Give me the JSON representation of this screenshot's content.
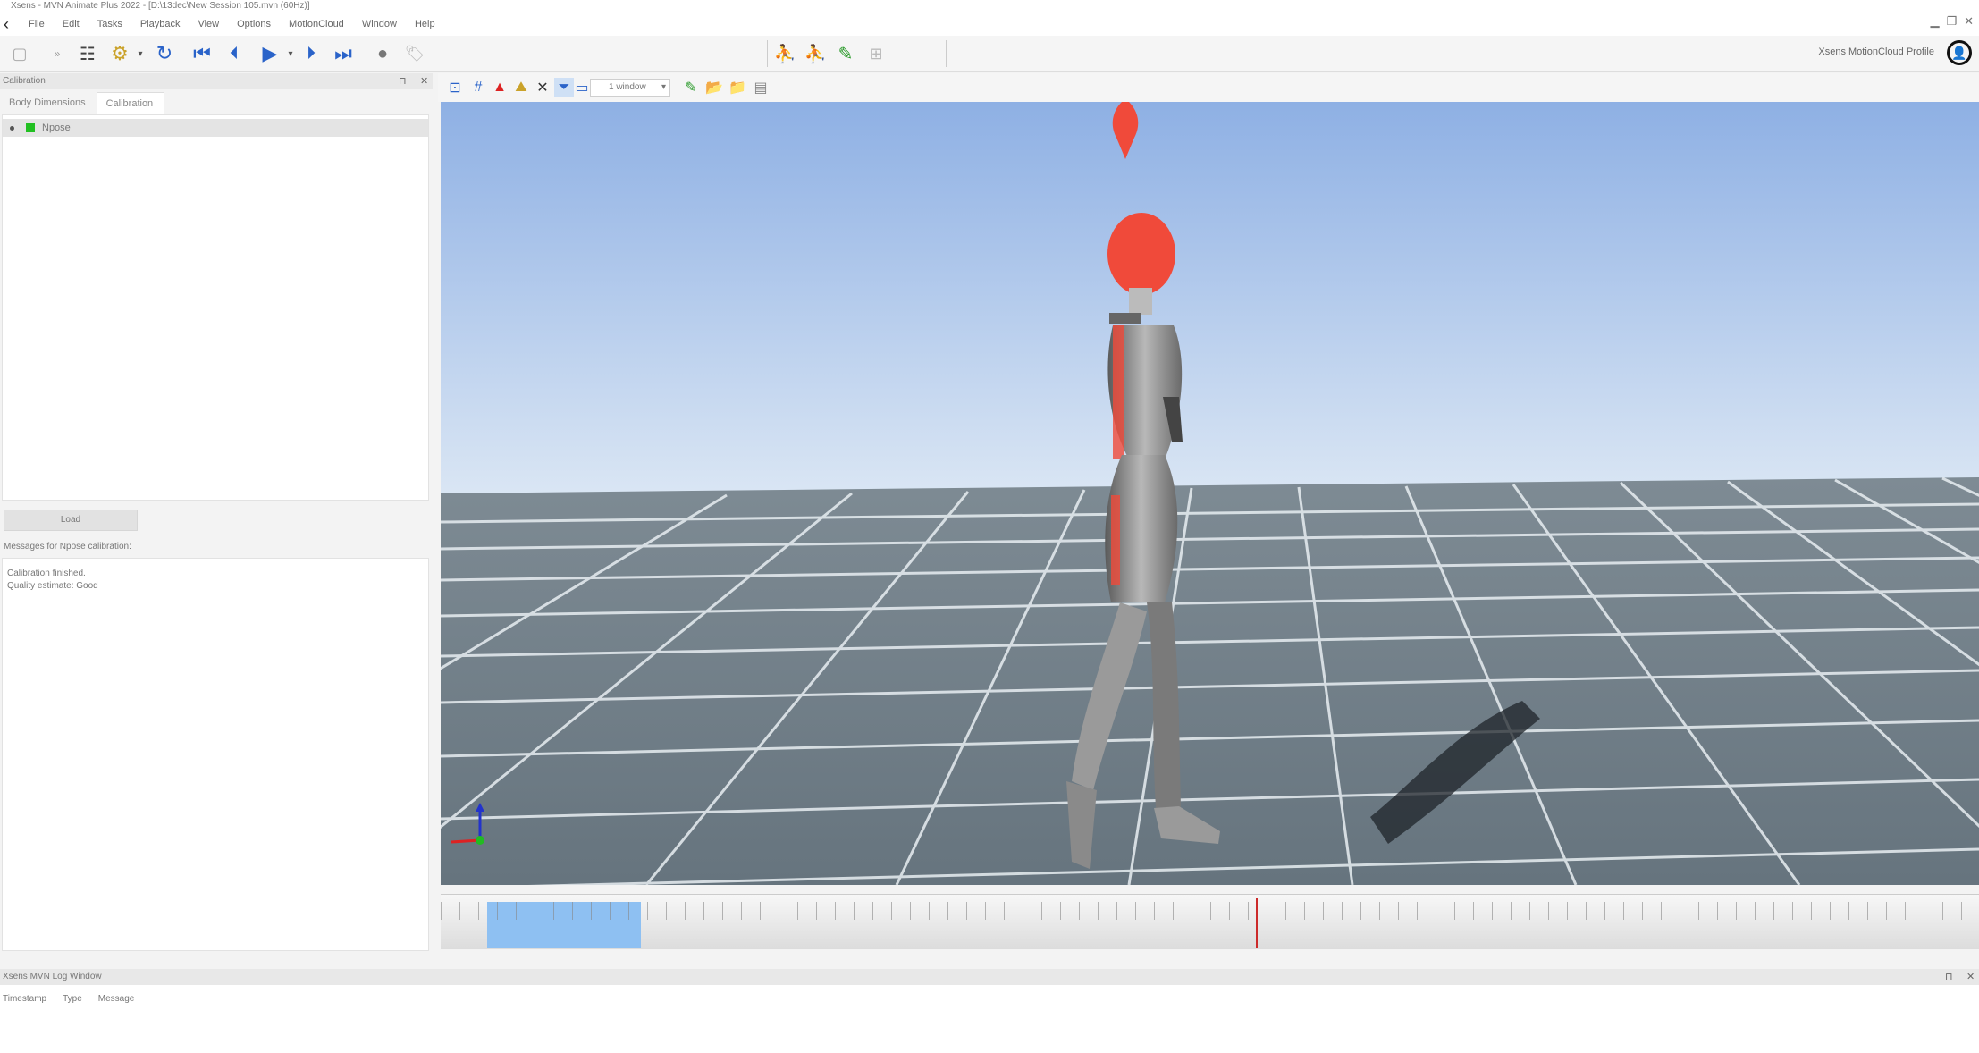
{
  "window": {
    "title": "Xsens - MVN Animate Plus 2022 - [D:\\13dec\\New Session 105.mvn (60Hz)]"
  },
  "menu": [
    "File",
    "Edit",
    "Tasks",
    "Playback",
    "View",
    "Options",
    "MotionCloud",
    "Window",
    "Help"
  ],
  "profile": {
    "label": "Xsens MotionCloud Profile"
  },
  "panel": {
    "title": "Calibration",
    "tabs": [
      "Body Dimensions",
      "Calibration"
    ],
    "active_tab": "Calibration",
    "calibration_item": "Npose",
    "load_button": "Load",
    "messages_label": "Messages for Npose calibration:",
    "messages": [
      "Calibration finished.",
      "Quality estimate: Good"
    ]
  },
  "viewport": {
    "window_select": "1 window"
  },
  "log": {
    "title": "Xsens MVN Log Window",
    "columns": [
      "Timestamp",
      "Type",
      "Message"
    ]
  },
  "timeline": {
    "selection": [
      0.03,
      0.13
    ],
    "playhead": 0.53
  },
  "colors": {
    "accent_blue": "#2a63c9",
    "sky_top": "#8eb0e4",
    "sky_bottom": "#dae6f4",
    "floor": "#6b7a85",
    "grid": "#e8eef2",
    "avatar_red": "#f04a3a",
    "selection": "#8ec0f2"
  }
}
